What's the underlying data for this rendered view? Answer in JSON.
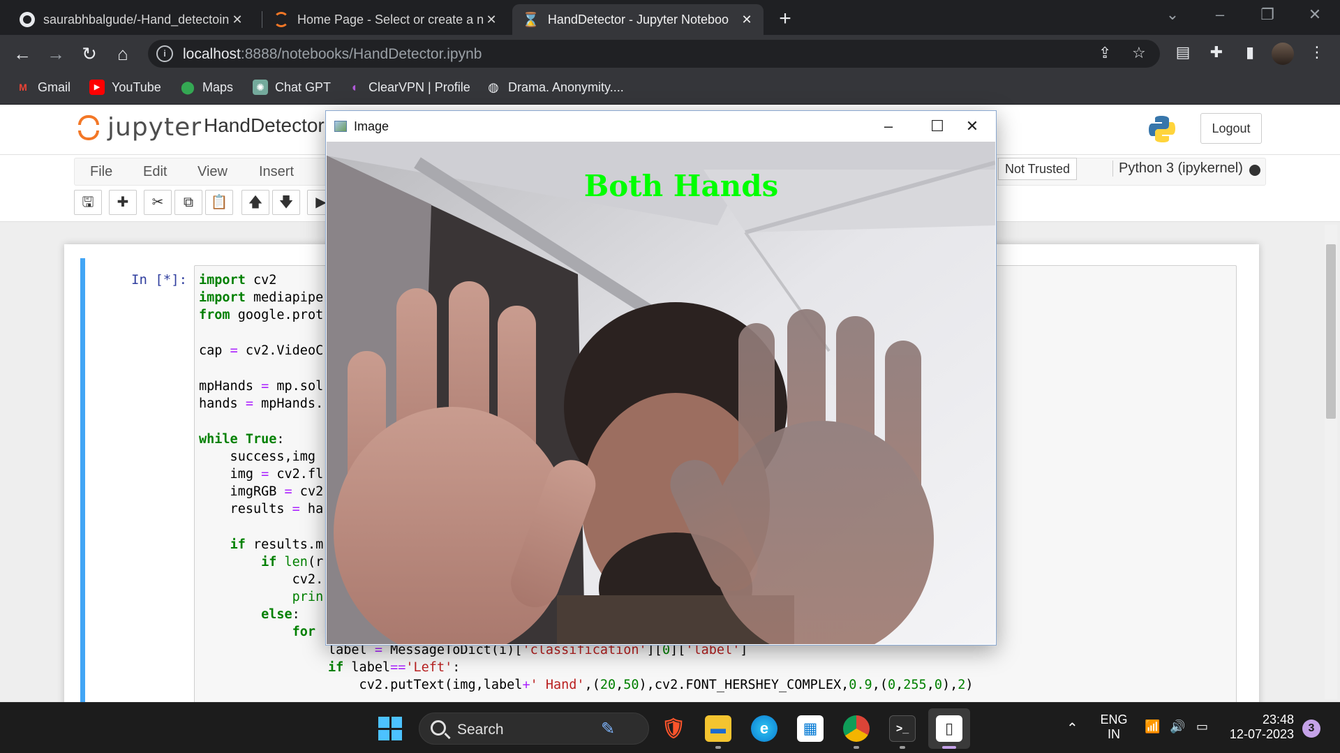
{
  "browser": {
    "tabs": [
      {
        "title": "saurabhbalgude/-Hand_detectoin",
        "icon": "github-icon",
        "active": false
      },
      {
        "title": "Home Page - Select or create a n",
        "icon": "jupyter-icon",
        "active": false
      },
      {
        "title": "HandDetector - Jupyter Noteboo",
        "icon": "hourglass-icon",
        "active": true
      }
    ],
    "new_tab_glyph": "+",
    "address": {
      "host": "localhost",
      "path": ":8888/notebooks/HandDetector.ipynb"
    },
    "bookmarks": [
      {
        "label": "Gmail",
        "icon": "gmail-icon",
        "color": "#ea4335"
      },
      {
        "label": "YouTube",
        "icon": "youtube-icon",
        "color": "#ff0000"
      },
      {
        "label": "Maps",
        "icon": "maps-icon",
        "color": "#34a853"
      },
      {
        "label": "Chat GPT",
        "icon": "chatgpt-icon",
        "color": "#74aa9c"
      },
      {
        "label": "ClearVPN | Profile",
        "icon": "clearvpn-icon",
        "color": "#b05ad8"
      },
      {
        "label": "Drama. Anonymity....",
        "icon": "globe-icon",
        "color": "#e8eaed"
      }
    ]
  },
  "jupyter": {
    "logo_text": "jupyter",
    "notebook_name": "HandDetector",
    "logout_label": "Logout",
    "menu": [
      "File",
      "Edit",
      "View",
      "Insert"
    ],
    "trust_status": "Not Trusted",
    "kernel": "Python 3 (ipykernel)",
    "cell_prompt": "In [*]:",
    "code_lines_left": [
      "import cv2",
      "import mediapipe",
      "from google.prot",
      "",
      "cap = cv2.VideoC",
      "",
      "mpHands = mp.sol",
      "hands = mpHands.",
      "",
      "while True:",
      "    success,img",
      "    img = cv2.fl",
      "    imgRGB = cv2",
      "    results = ha",
      "",
      "    if results.m",
      "        if len(r",
      "            cv2.",
      "            prin",
      "        else:",
      "            for"
    ],
    "code_lines_bottom": [
      "label = MessageToDict(i)['classification'][0]['label']",
      "if label=='Left':",
      "    cv2.putText(img,label+' Hand',(20,50),cv2.FONT_HERSHEY_COMPLEX,0.9,(0,255,0),2)"
    ]
  },
  "cv_window": {
    "title": "Image",
    "overlay_text": "Both Hands",
    "overlay_color": "#00ff00"
  },
  "taskbar": {
    "search_label": "Search",
    "language": "ENG",
    "region": "IN",
    "time": "23:48",
    "date": "12-07-2023",
    "notifications": "3"
  }
}
